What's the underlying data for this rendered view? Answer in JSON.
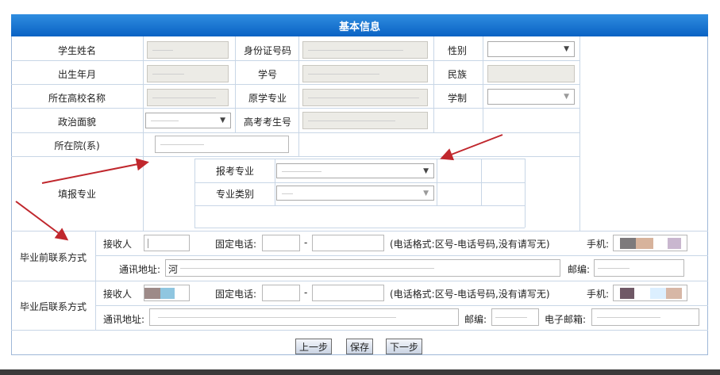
{
  "header": {
    "title": "基本信息"
  },
  "basic": {
    "name_label": "学生姓名",
    "idcard_label": "身份证号码",
    "gender_label": "性别",
    "birth_label": "出生年月",
    "student_no_label": "学号",
    "ethnic_label": "民族",
    "school_label": "所在高校名称",
    "major_label": "原学专业",
    "duration_label": "学制",
    "politics_label": "政治面貌",
    "exam_no_label": "高考考生号",
    "dept_label": "所在院(系)"
  },
  "apply": {
    "section_label": "填报专业",
    "major_label": "报考专业",
    "category_label": "专业类别"
  },
  "before": {
    "section_label": "毕业前联系方式",
    "receiver_label": "接收人",
    "phone_label": "固定电话:",
    "dash": "-",
    "format_hint": "(电话格式:区号-电话号码,没有请写无)",
    "mobile_label": "手机:",
    "address_label": "通讯地址:",
    "address_prefix": "河",
    "postcode_label": "邮编:"
  },
  "after": {
    "section_label": "毕业后联系方式",
    "receiver_label": "接收人",
    "phone_label": "固定电话:",
    "dash": "-",
    "format_hint": "(电话格式:区号-电话号码,没有请写无)",
    "mobile_label": "手机:",
    "address_label": "通讯地址:",
    "postcode_label": "邮编:",
    "email_label": "电子邮箱:"
  },
  "buttons": {
    "prev": "上一步",
    "save": "保存",
    "next": "下一步"
  },
  "colors": {
    "header": "#0a62c4",
    "arrow": "#c0272d",
    "field_gray": "#ecebe6"
  }
}
